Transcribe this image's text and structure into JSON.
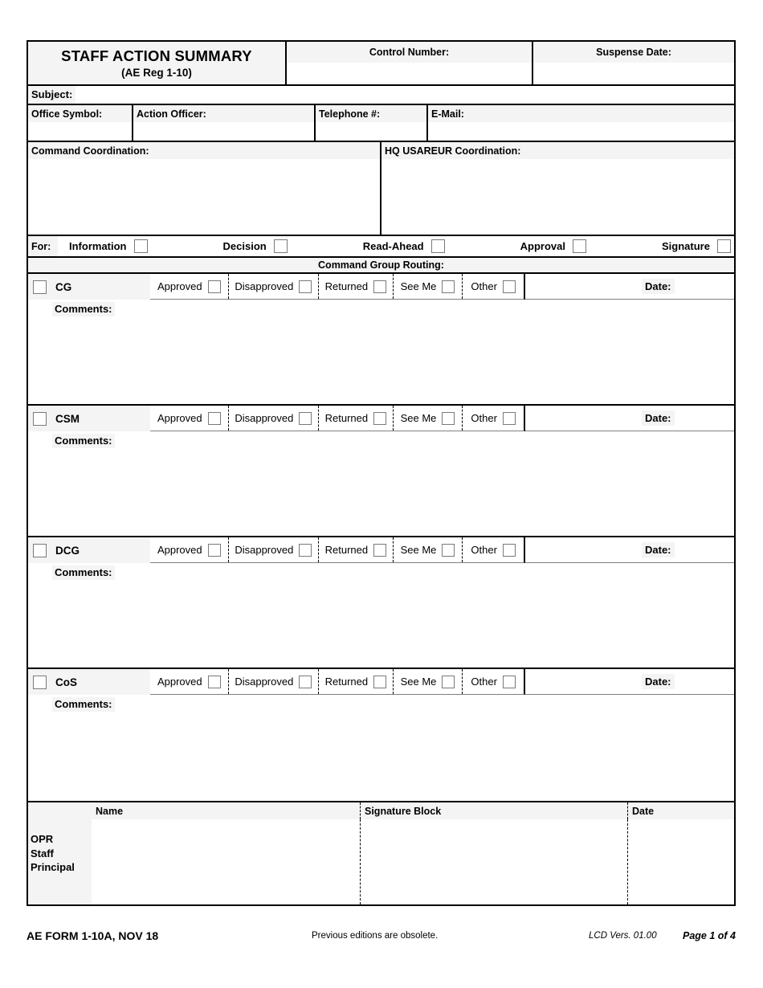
{
  "form": {
    "title": "STAFF ACTION SUMMARY",
    "regulation": "(AE Reg 1-10)",
    "control_number_label": "Control Number:",
    "suspense_date_label": "Suspense Date:",
    "subject_label": "Subject:",
    "office_symbol_label": "Office Symbol:",
    "action_officer_label": "Action Officer:",
    "telephone_label": "Telephone #:",
    "email_label": "E-Mail:",
    "command_coordination_label": "Command Coordination:",
    "hq_usareur_coordination_label": "HQ USAREUR Coordination:"
  },
  "for_row": {
    "label": "For:",
    "options": [
      {
        "label": "Information",
        "checked": false
      },
      {
        "label": "Decision",
        "checked": false
      },
      {
        "label": "Read-Ahead",
        "checked": false
      },
      {
        "label": "Approval",
        "checked": false
      },
      {
        "label": "Signature",
        "checked": false
      }
    ]
  },
  "routing": {
    "header": "Command Group Routing:",
    "action_labels": {
      "approved": "Approved",
      "disapproved": "Disapproved",
      "returned": "Returned",
      "see_me": "See Me",
      "other": "Other"
    },
    "date_label": "Date:",
    "comments_label": "Comments:",
    "rows": [
      {
        "name": "CG",
        "checked": false,
        "date_value": "",
        "comments_value": ""
      },
      {
        "name": "CSM",
        "checked": false,
        "date_value": "",
        "comments_value": ""
      },
      {
        "name": "DCG",
        "checked": false,
        "date_value": "",
        "comments_value": ""
      },
      {
        "name": "CoS",
        "checked": false,
        "date_value": "",
        "comments_value": ""
      }
    ]
  },
  "opr_block": {
    "row_label": "OPR\nStaff\nPrincipal",
    "columns": [
      "Name",
      "Signature Block",
      "Date"
    ],
    "values": [
      "",
      "",
      ""
    ]
  },
  "footer": {
    "form_number": "AE FORM 1-10A, NOV 18",
    "note": "Previous editions are obsolete.",
    "version": "LCD Vers. 01.00",
    "page": "Page 1 of 4"
  }
}
